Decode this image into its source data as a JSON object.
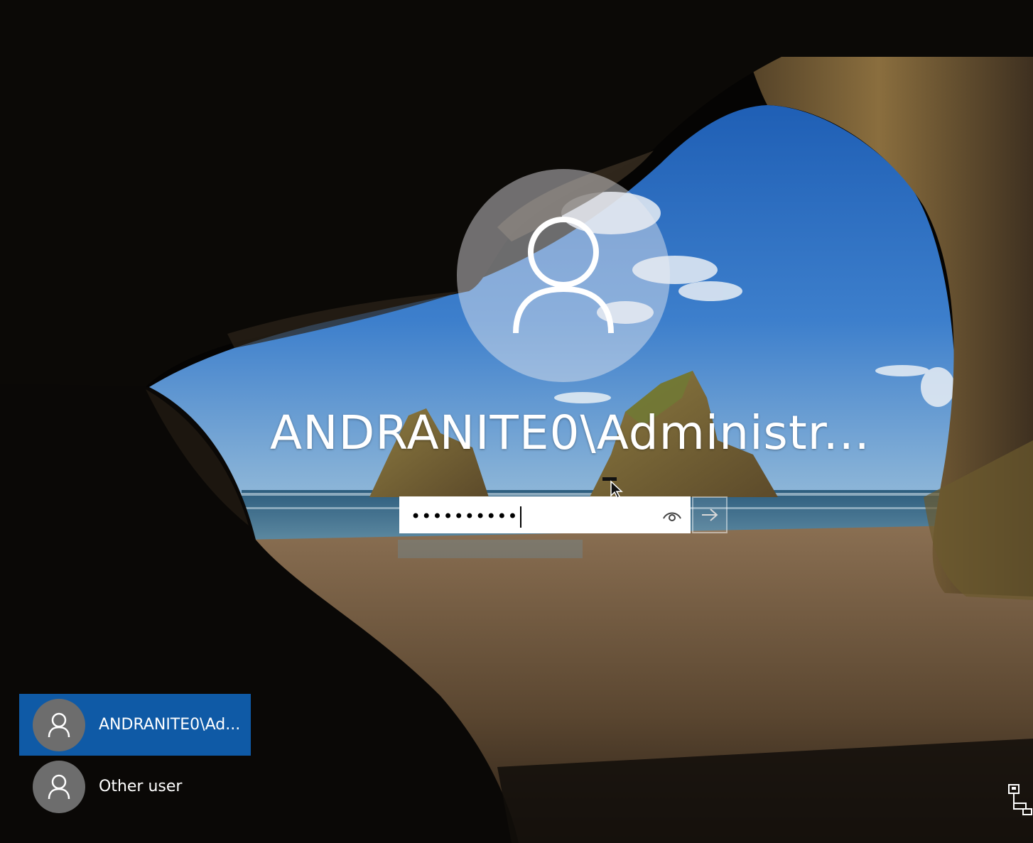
{
  "screen": "Windows sign-in screen",
  "login": {
    "username": "ANDRANITE0\\Administr...",
    "password_masked": "••••••••••",
    "reveal_icon": "eye-icon",
    "submit_icon": "arrow-right-icon"
  },
  "user_list": [
    {
      "label": "ANDRANITE0\\Ad...",
      "selected": true,
      "icon": "user-icon"
    },
    {
      "label": "Other user",
      "selected": false,
      "icon": "user-icon"
    }
  ],
  "tray": {
    "network_icon": "network-icon"
  },
  "colors": {
    "selected_user_bg": "#0f5aa6",
    "tile_avatar_bg": "#6d6d6d"
  }
}
